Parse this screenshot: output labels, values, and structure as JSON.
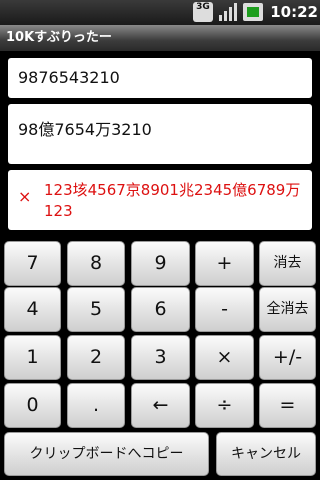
{
  "status_bar": {
    "network": "3G",
    "time": "10:22"
  },
  "app": {
    "title": "10Kすぶりったー"
  },
  "display": {
    "input": "9876543210",
    "converted": "98億7654万3210",
    "result_prefix": "×",
    "result": "123垓4567京8901兆2345億6789万123",
    "result_color": "#dd1111"
  },
  "keypad": {
    "keys": [
      "7",
      "8",
      "9",
      "+",
      "消去",
      "4",
      "5",
      "6",
      "-",
      "全消去",
      "1",
      "2",
      "3",
      "×",
      "+/-",
      "0",
      ".",
      "←",
      "÷",
      "="
    ],
    "copy_label": "クリップボードへコピー",
    "cancel_label": "キャンセル"
  }
}
